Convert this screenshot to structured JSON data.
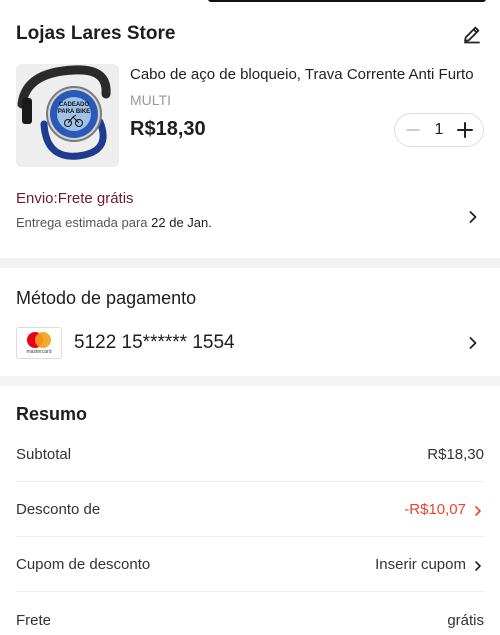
{
  "store": {
    "name": "Lojas Lares Store"
  },
  "product": {
    "title": "Cabo de aço de bloqueio, Trava Corrente Anti Furto",
    "variant": "MULTI",
    "price": "R$18,30",
    "image_label": "CADEADO PARA BIKE",
    "quantity": "1"
  },
  "shipping": {
    "label": "Envio:Frete grátis",
    "estimate_prefix": "Entrega estimada para ",
    "estimate_date": "22 de Jan."
  },
  "payment": {
    "title": "Método de pagamento",
    "card_brand": "mastercard",
    "card_number": "5122 15****** 1554"
  },
  "summary": {
    "title": "Resumo",
    "rows": [
      {
        "label": "Subtotal",
        "value": "R$18,30"
      },
      {
        "label": "Desconto de",
        "value": "-R$10,07"
      },
      {
        "label": "Cupom de desconto",
        "value": "Inserir cupom"
      },
      {
        "label": "Frete",
        "value": "grátis"
      }
    ]
  },
  "colors": {
    "shipping_text": "#6f1a33",
    "discount": "#e8452c",
    "divider": "#f3f3f3"
  },
  "icons": [
    "edit-icon",
    "minus-icon",
    "plus-icon",
    "chevron-right-icon",
    "mastercard-icon"
  ]
}
